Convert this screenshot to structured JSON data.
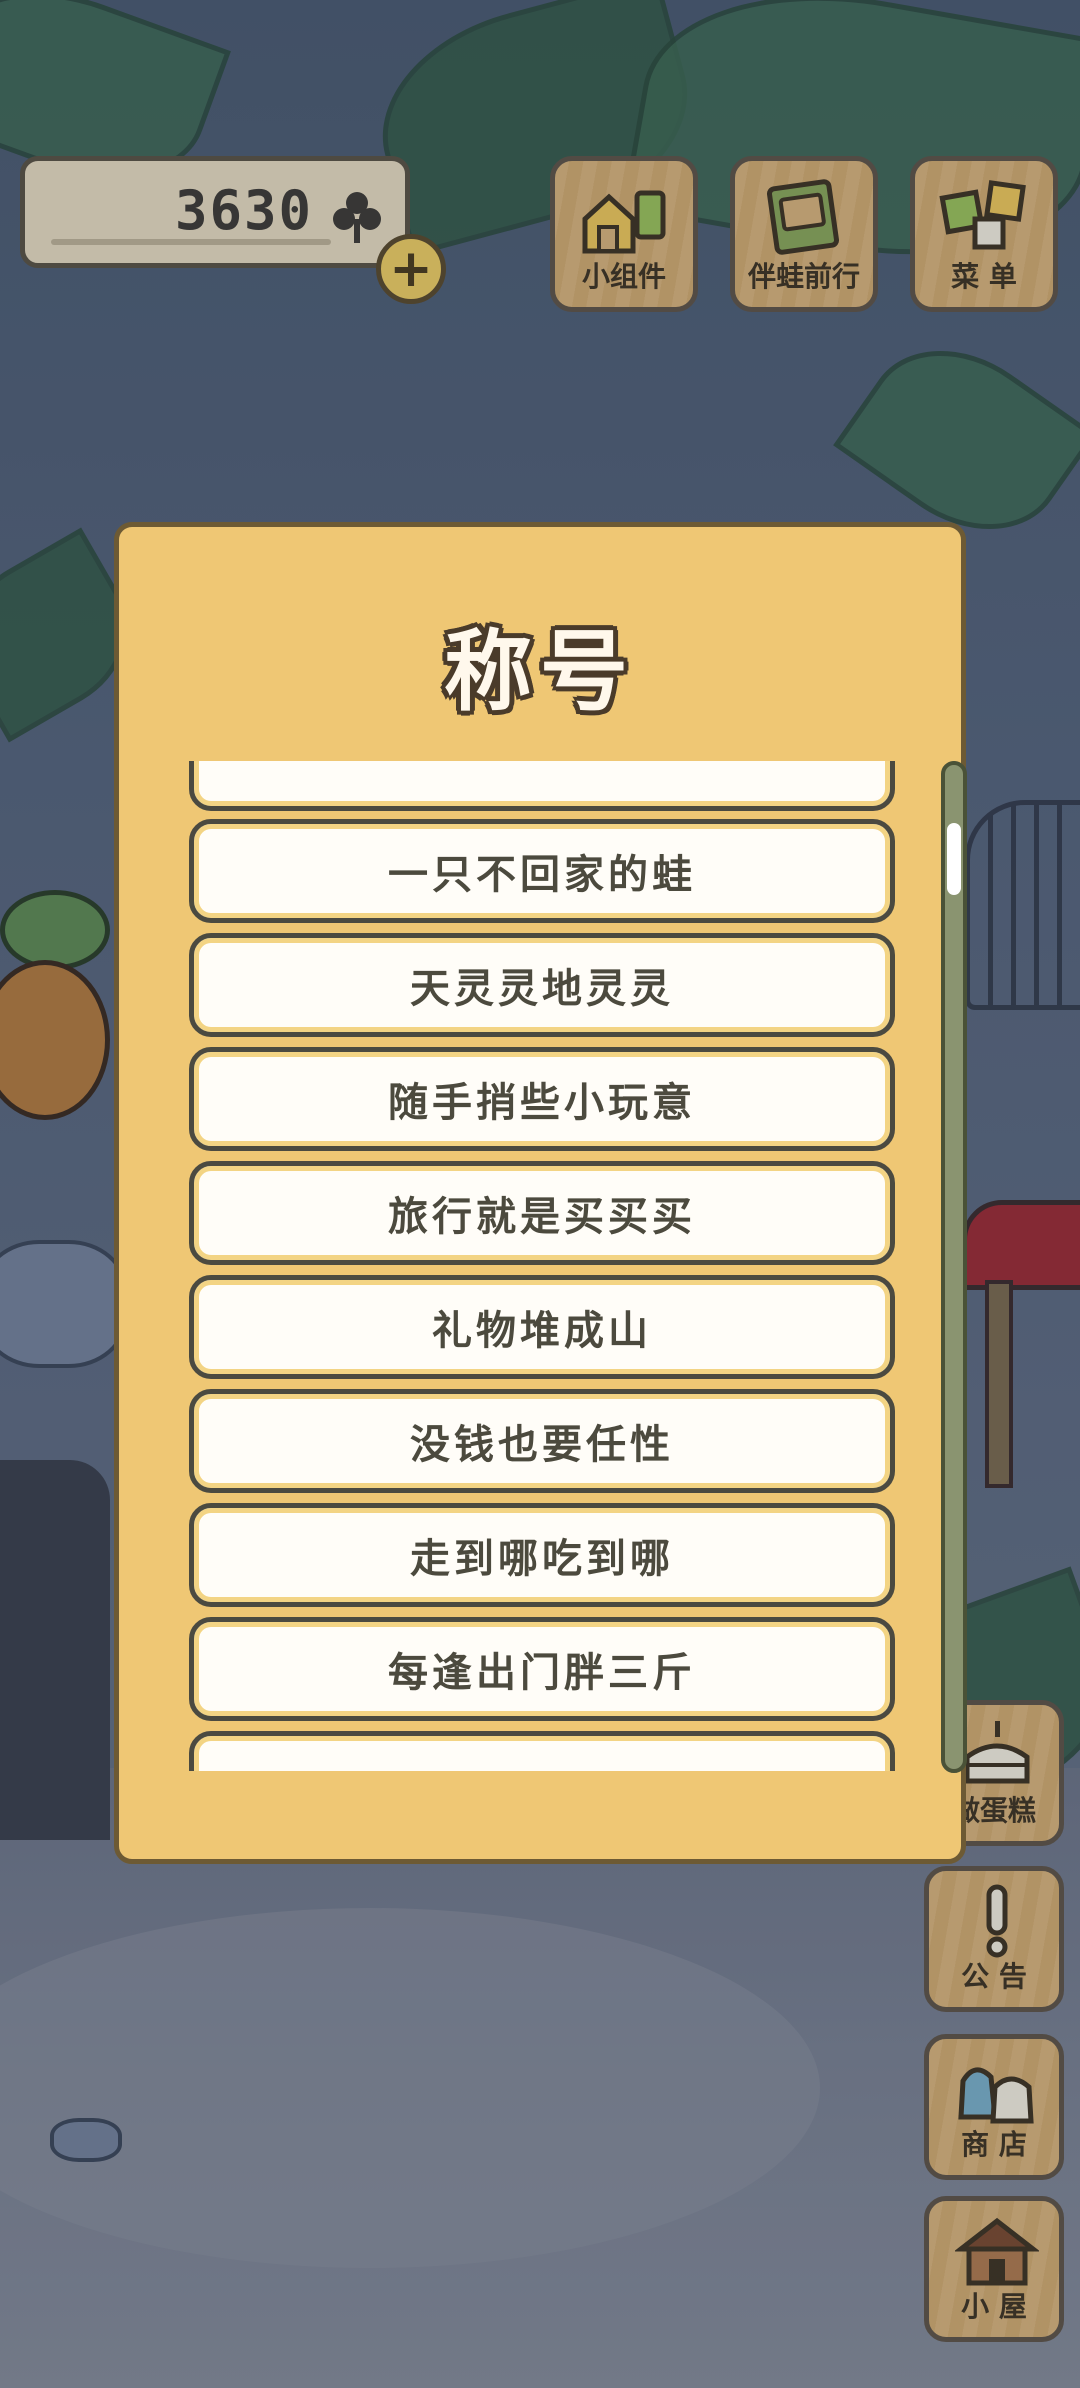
{
  "hud": {
    "currency_value": "3630",
    "currency_icon": "clover-icon",
    "add_currency_icon": "plus-icon"
  },
  "top_buttons": [
    {
      "label": "小组件",
      "icon": "widget-icon"
    },
    {
      "label": "伴蛙前行",
      "icon": "book-icon"
    },
    {
      "label": "菜 单",
      "icon": "menu-icon"
    }
  ],
  "side_buttons": [
    {
      "label": "做蛋糕",
      "icon": "cake-icon"
    },
    {
      "label": "公 告",
      "icon": "exclamation-icon"
    },
    {
      "label": "商 店",
      "icon": "shop-bags-icon"
    },
    {
      "label": "小 屋",
      "icon": "house-icon"
    }
  ],
  "modal": {
    "title": "称号",
    "items": [
      {
        "label": ""
      },
      {
        "label": "一只不回家的蛙"
      },
      {
        "label": "天灵灵地灵灵"
      },
      {
        "label": "随手捎些小玩意"
      },
      {
        "label": "旅行就是买买买"
      },
      {
        "label": "礼物堆成山"
      },
      {
        "label": "没钱也要任性"
      },
      {
        "label": "走到哪吃到哪"
      },
      {
        "label": "每逢出门胖三斤"
      },
      {
        "label": ""
      }
    ],
    "scroll_position": 0.06
  },
  "colors": {
    "modal_bg": "#efc774",
    "item_bg": "#fffdf8",
    "wood": "#d9b47a",
    "accent_gold": "#f0cf62"
  }
}
